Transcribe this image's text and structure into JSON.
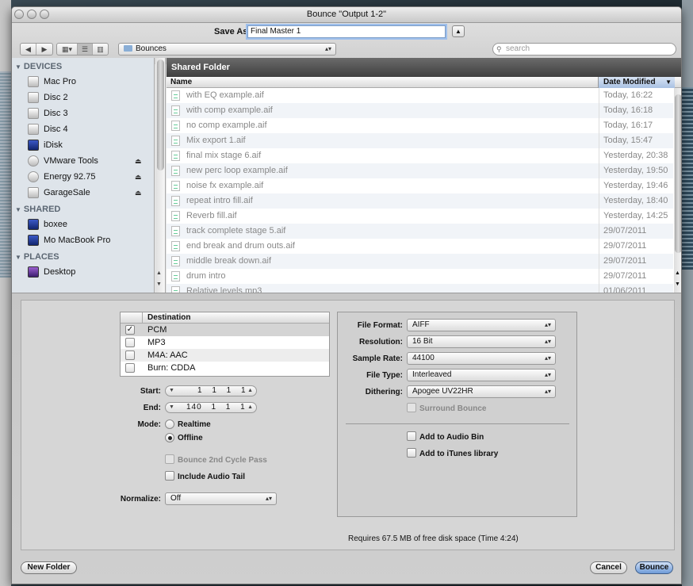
{
  "window": {
    "title": "Bounce \"Output 1-2\""
  },
  "save_as": {
    "label": "Save As:",
    "value": "Final Master 1"
  },
  "location": {
    "folder": "Bounces"
  },
  "search": {
    "placeholder": "search"
  },
  "sidebar": {
    "devices_heading": "DEVICES",
    "devices": [
      {
        "label": "Mac Pro",
        "icon": "hard-drive-icon"
      },
      {
        "label": "Disc 2",
        "icon": "hard-drive-icon"
      },
      {
        "label": "Disc 3",
        "icon": "hard-drive-icon"
      },
      {
        "label": "Disc 4",
        "icon": "hard-drive-icon"
      },
      {
        "label": "iDisk",
        "icon": "idisk-icon"
      },
      {
        "label": "VMware Tools",
        "icon": "cd-disc-icon"
      },
      {
        "label": "Energy 92.75",
        "icon": "cd-disc-icon"
      },
      {
        "label": "GarageSale",
        "icon": "disk-image-icon"
      }
    ],
    "shared_heading": "SHARED",
    "shared": [
      {
        "label": "boxee",
        "icon": "computer-icon"
      },
      {
        "label": "Mo MacBook Pro",
        "icon": "computer-icon"
      }
    ],
    "places_heading": "PLACES",
    "places": [
      {
        "label": "Desktop",
        "icon": "desktop-icon"
      }
    ]
  },
  "file_browser": {
    "header": "Shared Folder",
    "col_name": "Name",
    "col_date": "Date Modified",
    "files": [
      {
        "name": "with EQ example.aif",
        "date": "Today, 16:22"
      },
      {
        "name": "with comp example.aif",
        "date": "Today, 16:18"
      },
      {
        "name": "no comp example.aif",
        "date": "Today, 16:17"
      },
      {
        "name": "Mix export 1.aif",
        "date": "Today, 15:47"
      },
      {
        "name": "final mix stage 6.aif",
        "date": "Yesterday, 20:38"
      },
      {
        "name": "new perc loop example.aif",
        "date": "Yesterday, 19:50"
      },
      {
        "name": "noise fx example.aif",
        "date": "Yesterday, 19:46"
      },
      {
        "name": "repeat intro fill.aif",
        "date": "Yesterday, 18:40"
      },
      {
        "name": "Reverb fill.aif",
        "date": "Yesterday, 14:25"
      },
      {
        "name": "track complete stage 5.aif",
        "date": "29/07/2011"
      },
      {
        "name": "end break and drum outs.aif",
        "date": "29/07/2011"
      },
      {
        "name": "middle break down.aif",
        "date": "29/07/2011"
      },
      {
        "name": "drum intro",
        "date": "29/07/2011"
      },
      {
        "name": "Relative levels.mp3",
        "date": "01/06/2011"
      }
    ]
  },
  "destination": {
    "header": "Destination",
    "rows": [
      {
        "label": "PCM",
        "checked": true,
        "mark": "✓"
      },
      {
        "label": "MP3",
        "checked": false,
        "mark": ""
      },
      {
        "label": "M4A: AAC",
        "checked": false,
        "mark": ""
      },
      {
        "label": "Burn: CDDA",
        "checked": false,
        "mark": ""
      }
    ]
  },
  "range": {
    "start_label": "Start:",
    "start_value": "1 1 1 1",
    "end_label": "End:",
    "end_value": "140 1 1 1"
  },
  "mode": {
    "label": "Mode:",
    "realtime": "Realtime",
    "offline": "Offline",
    "selected": "Offline"
  },
  "options": {
    "bounce_2nd_cycle": "Bounce 2nd Cycle Pass",
    "include_audio_tail": "Include Audio Tail"
  },
  "normalize": {
    "label": "Normalize:",
    "value": "Off"
  },
  "format": {
    "file_format_label": "File Format:",
    "file_format": "AIFF",
    "resolution_label": "Resolution:",
    "resolution": "16 Bit",
    "sample_rate_label": "Sample Rate:",
    "sample_rate": "44100",
    "file_type_label": "File Type:",
    "file_type": "Interleaved",
    "dithering_label": "Dithering:",
    "dithering": "Apogee UV22HR",
    "surround_bounce": "Surround Bounce",
    "add_audio_bin": "Add to Audio Bin",
    "add_itunes": "Add to iTunes library"
  },
  "disk_info": "Requires 67.5 MB of free disk space  (Time 4:24)",
  "buttons": {
    "new_folder": "New Folder",
    "cancel": "Cancel",
    "bounce": "Bounce"
  },
  "colors": {
    "accent": "#6e9bd8",
    "header_dark": "#3f3f3f",
    "sidebar_bg": "#dee4ea"
  }
}
